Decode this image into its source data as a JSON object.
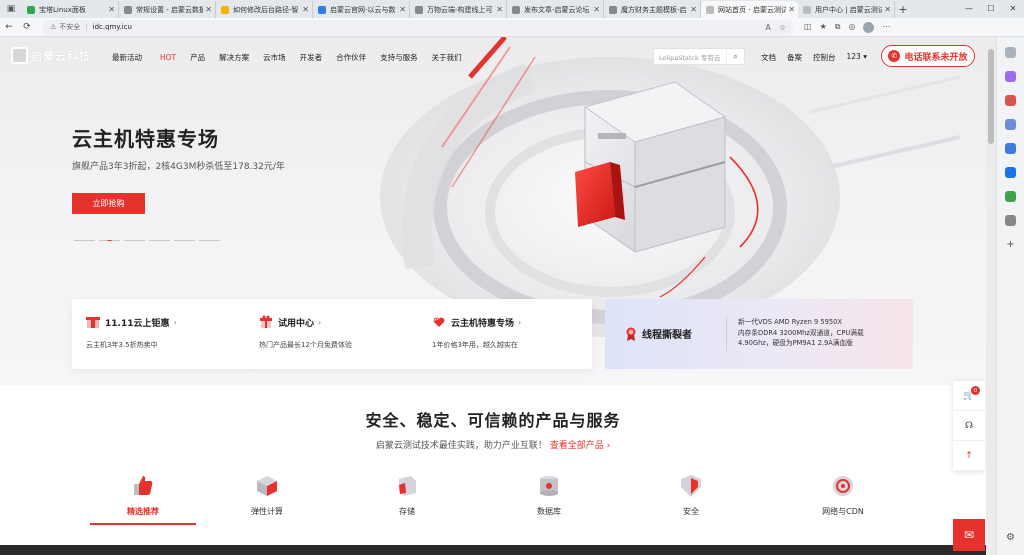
{
  "browser": {
    "tabs": [
      {
        "title": "宝塔Linux面板",
        "active": false
      },
      {
        "title": "常规设置 - 启蒙云数据",
        "active": false
      },
      {
        "title": "如何修改后台路径-智",
        "active": false
      },
      {
        "title": "启蒙云官网-以云与数",
        "active": false
      },
      {
        "title": "万物云端-构建线上可",
        "active": false
      },
      {
        "title": "发布文章-启蒙云论坛",
        "active": false
      },
      {
        "title": "魔方财务主题模板-启",
        "active": false
      },
      {
        "title": "网站首页 - 启蒙云测试",
        "active": true
      },
      {
        "title": "用户中心 | 启蒙云测试",
        "active": false
      }
    ],
    "new_tab": "+",
    "security_label": "不安全",
    "url": "idc.qmy.icu"
  },
  "site": {
    "logo_text": "启蒙云科技",
    "menu": [
      "最新活动",
      "产品",
      "解决方案",
      "云市场",
      "开发者",
      "合作伙伴",
      "支持与服务",
      "关于我们"
    ],
    "hot_badge": "HOT",
    "search_placeholder": "LolipaStatck 专有云",
    "right_links": [
      "文档",
      "备案",
      "控制台",
      "123 ▾"
    ],
    "call_button": "电话联系未开放"
  },
  "hero": {
    "title": "云主机特惠专场",
    "subtitle": "旗舰产品3年3折起，2核4G3M秒杀低至178.32元/年",
    "cta": "立即抢购",
    "slides": 6,
    "active_slide": 1
  },
  "promo_cards": [
    {
      "title": "11.11云上钜惠",
      "desc": "云主机3年3.5折热卖中"
    },
    {
      "title": "试用中心",
      "desc": "热门产品最长12个月免费体验"
    },
    {
      "title": "云主机特惠专场",
      "desc": "1年价格3年用，越久越实在"
    }
  ],
  "chevron": "›",
  "feature_card": {
    "title": "线程撕裂者",
    "lines": [
      "新一代VDS AMD Ryzen 9 5950X",
      "内存条DDR4 3200Mhz双通道，CPU满载",
      "4.90Ghz，硬盘为PM9A1 2.9A满血版"
    ]
  },
  "products": {
    "title": "安全、稳定、可信赖的产品与服务",
    "subtitle": "启蒙云测试技术最佳实践，助力产业互联！",
    "link": "查看全部产品 ›",
    "categories": [
      "精选推荐",
      "弹性计算",
      "存储",
      "数据库",
      "安全",
      "网络与CDN"
    ],
    "active_category": 0
  },
  "floating": {
    "cart_count": "0"
  },
  "colors": {
    "accent": "#e5322d",
    "dark": "#222222"
  }
}
